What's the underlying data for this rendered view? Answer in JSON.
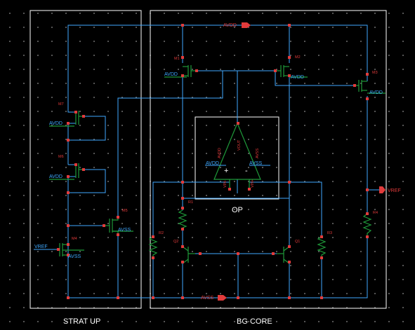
{
  "blocks": {
    "startup": "STRAT UP",
    "core": "BG CORE",
    "opamp": "OP"
  },
  "nets": {
    "avdd_top": "AVDD",
    "avss_bottom": "AVSS",
    "vref_out": "VREF",
    "vref_in": "VREF"
  },
  "devices": {
    "m1": "M1",
    "m2": "M2",
    "m3": "M3",
    "m4": "M4",
    "m5": "M5",
    "m6": "M6",
    "m7": "M7",
    "r1": "R1",
    "r2": "R2",
    "r3": "R3",
    "r4": "R4",
    "q1": "Q1",
    "q2": "Q2"
  },
  "pins": {
    "m1_bulk": "AVDD",
    "m2_bulk": "AVDD",
    "m3_bulk": "AVDD",
    "m7_bulk": "AVDD",
    "m6_bulk": "AVDD",
    "m5_bulk": "AVSS",
    "m4_bulk": "AVSS",
    "op_avdd_pin": "AVDD",
    "op_avss_pin": "AVSS",
    "op_vout": "VOUT",
    "op_avdd_rot": "AVDD",
    "op_avss_rot": "AVSS",
    "op_vinn": "VIN-",
    "op_vinp": "VIN+",
    "op_plus": "+",
    "op_minus": "-"
  },
  "colors": {
    "wire": "#3fa9ff",
    "device": "#1f9a3a",
    "node": "#e23b3b",
    "frame": "#ffffff"
  }
}
